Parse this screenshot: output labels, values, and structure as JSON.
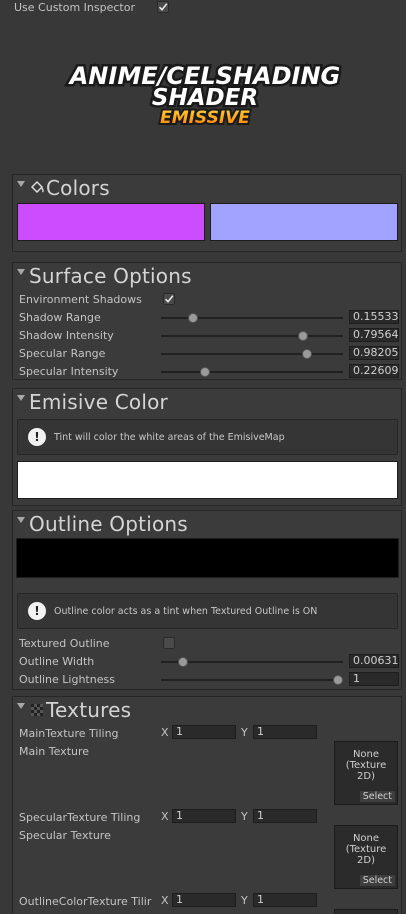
{
  "top": {
    "custom_inspector_label": "Use Custom Inspector",
    "custom_inspector_checked": true
  },
  "logo": {
    "line1": "ANIME/CELSHADING",
    "line2": "SHADER",
    "line3": "EMISSIVE"
  },
  "colors": {
    "title": "Colors",
    "swatch_left": "#cc4dff",
    "swatch_right": "#a2a2ff"
  },
  "surface": {
    "title": "Surface Options",
    "env_shadows_label": "Environment Shadows",
    "env_shadows_checked": true,
    "sliders": [
      {
        "label": "Shadow Range",
        "value": "0.15533",
        "fraction": 0.155
      },
      {
        "label": "Shadow Intensity",
        "value": "0.79564",
        "fraction": 0.796
      },
      {
        "label": "Specular Range",
        "value": "0.98205",
        "fraction": 0.822
      },
      {
        "label": "Specular Intensity",
        "value": "0.22609",
        "fraction": 0.226
      }
    ]
  },
  "emissive": {
    "title": "Emisive Color",
    "help": "Tint will color the white areas of the EmisiveMap",
    "swatch": "#ffffff"
  },
  "outline": {
    "title": "Outline Options",
    "swatch": "#000000",
    "help": "Outline color acts as a tint when Textured Outline is ON",
    "textured_label": "Textured Outline",
    "textured_checked": false,
    "width_label": "Outline Width",
    "width_value": "0.00631",
    "width_fraction": 0.1,
    "lightness_label": "Outline Lightness",
    "lightness_value": "1",
    "lightness_fraction": 1.0
  },
  "textures": {
    "title": "Textures",
    "x_label": "X",
    "y_label": "Y",
    "slots": [
      {
        "tiling_label": "MainTexture Tiling",
        "x": "1",
        "y": "1",
        "tex_label": "Main Texture",
        "box_text": [
          "None",
          "(Texture",
          "2D)"
        ],
        "select": "Select"
      },
      {
        "tiling_label": "SpecularTexture Tiling",
        "x": "1",
        "y": "1",
        "tex_label": "Specular Texture",
        "box_text": [
          "None",
          "(Texture",
          "2D)"
        ],
        "select": "Select"
      },
      {
        "tiling_label": "OutlineColorTexture Tilir",
        "x": "1",
        "y": "1"
      }
    ]
  }
}
